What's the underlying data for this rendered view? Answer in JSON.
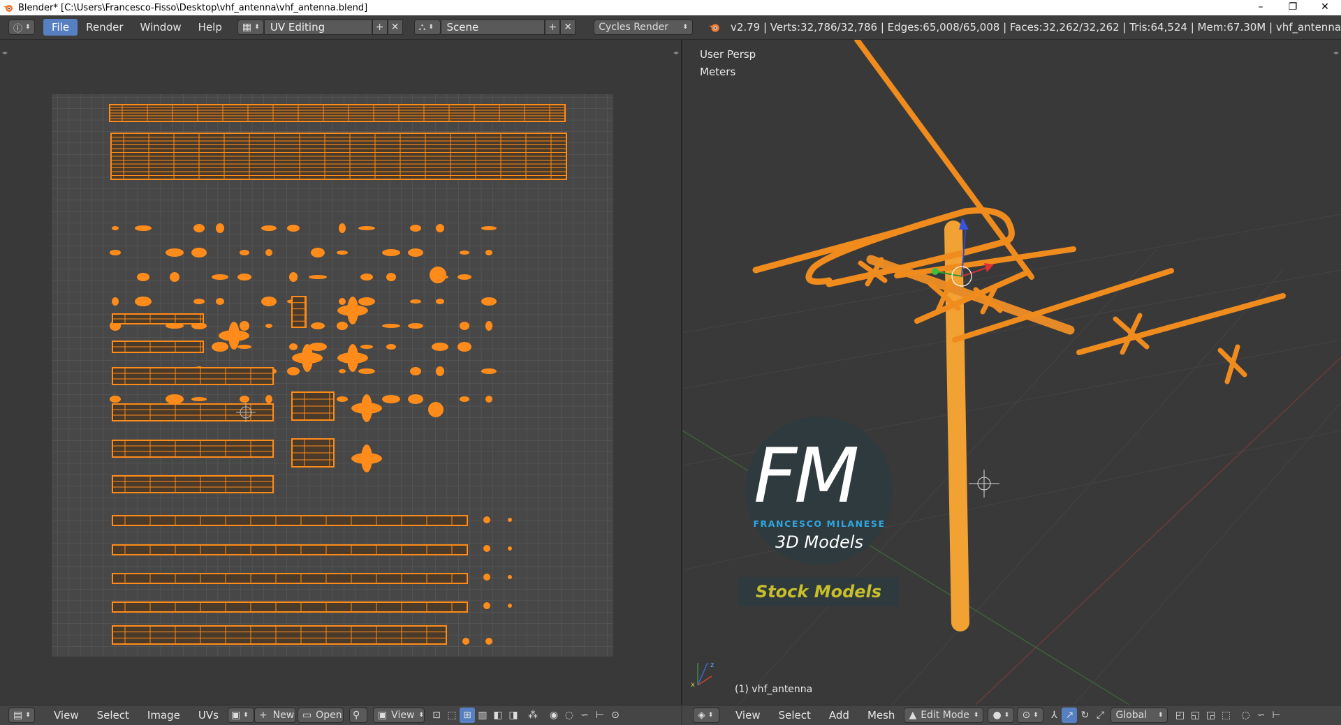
{
  "window": {
    "title": "Blender* [C:\\Users\\Francesco-Fisso\\Desktop\\vhf_antenna\\vhf_antenna.blend]",
    "controls": [
      "–",
      "❐",
      "✕"
    ]
  },
  "infobar": {
    "menus": [
      "File",
      "Render",
      "Window",
      "Help"
    ],
    "screen_layout": "UV Editing",
    "scene": "Scene",
    "render_engine": "Cycles Render",
    "stats": "v2.79 | Verts:32,786/32,786 | Edges:65,008/65,008 | Faces:32,262/32,262 | Tris:64,524 | Mem:67.30M | vhf_antenna"
  },
  "uv_editor": {
    "footer": {
      "menus": [
        "View",
        "Select",
        "Image",
        "UVs"
      ],
      "new_label": "New",
      "open_label": "Open",
      "view_label": "View"
    }
  },
  "viewport": {
    "view_name": "User Persp",
    "units": "Meters",
    "object_label": "(1) vhf_antenna",
    "watermark": {
      "letters": "FM",
      "studio": "FRANCESCO MILANESE",
      "tagline": "3D Models",
      "badge": "Stock Models"
    },
    "footer": {
      "menus": [
        "View",
        "Select",
        "Add",
        "Mesh"
      ],
      "mode": "Edit Mode",
      "orientation": "Global"
    }
  },
  "colors": {
    "accent": "#5680c2",
    "mesh": "#f08c1e",
    "uv": "#ff8c1a",
    "background": "#393939"
  }
}
